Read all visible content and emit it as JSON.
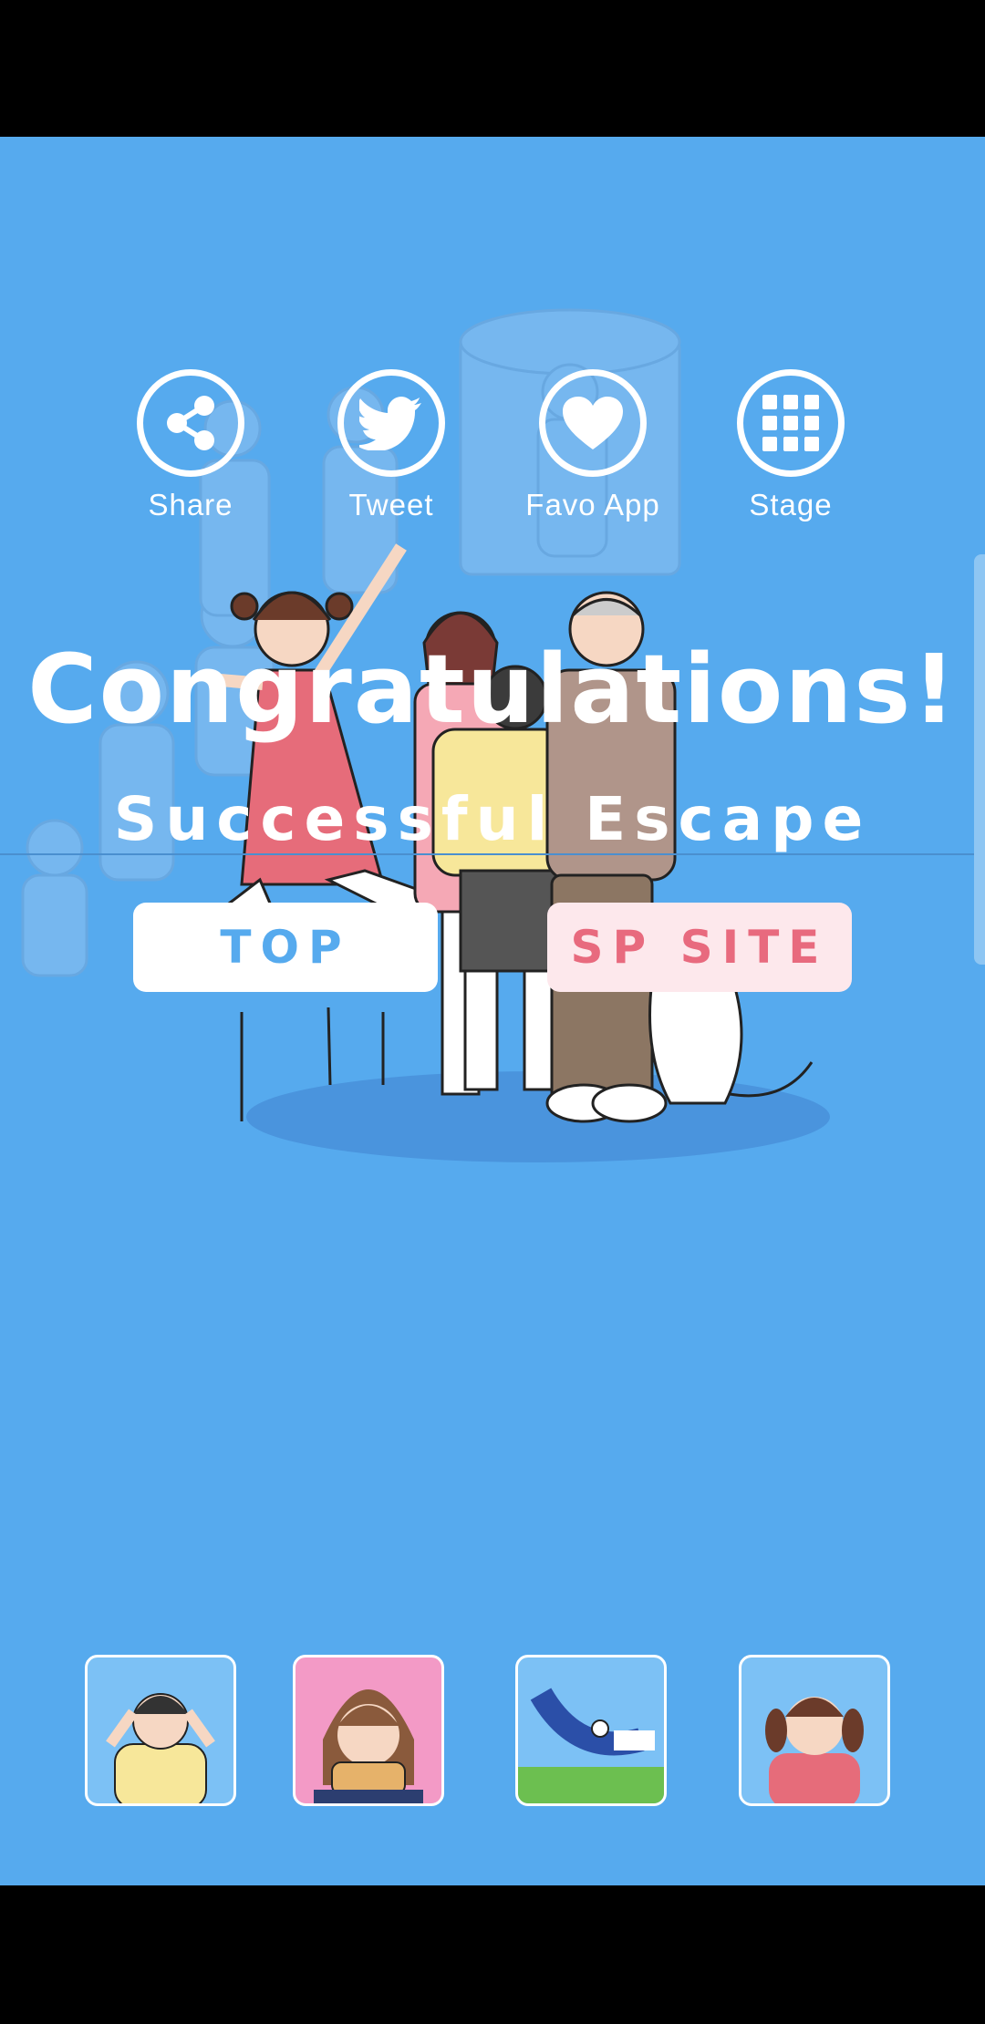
{
  "share_bar": {
    "share_label": "Share",
    "tweet_label": "Tweet",
    "favo_label": "Favo App",
    "stage_label": "Stage"
  },
  "result": {
    "title": "Congratulations!",
    "subtitle": "Successful Escape"
  },
  "buttons": {
    "top_label": "TOP",
    "sp_site_label": "SP SITE"
  },
  "thumbnails": [
    {
      "icon": "boy-holding-head-icon"
    },
    {
      "icon": "girl-with-toast-icon"
    },
    {
      "icon": "baseball-player-icon"
    },
    {
      "icon": "girl-pigtails-icon"
    }
  ],
  "colors": {
    "background": "#56aaee",
    "white": "#ffffff",
    "sp_site_text": "#e86a7e",
    "sp_site_bg": "#fde8ec"
  }
}
